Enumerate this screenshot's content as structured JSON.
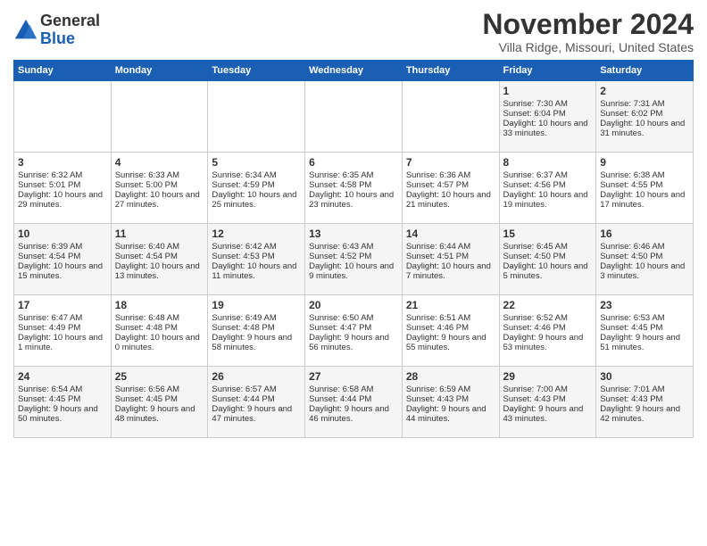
{
  "header": {
    "logo_line1": "General",
    "logo_line2": "Blue",
    "month_title": "November 2024",
    "location": "Villa Ridge, Missouri, United States"
  },
  "days_of_week": [
    "Sunday",
    "Monday",
    "Tuesday",
    "Wednesday",
    "Thursday",
    "Friday",
    "Saturday"
  ],
  "weeks": [
    [
      {
        "day": "",
        "sunrise": "",
        "sunset": "",
        "daylight": ""
      },
      {
        "day": "",
        "sunrise": "",
        "sunset": "",
        "daylight": ""
      },
      {
        "day": "",
        "sunrise": "",
        "sunset": "",
        "daylight": ""
      },
      {
        "day": "",
        "sunrise": "",
        "sunset": "",
        "daylight": ""
      },
      {
        "day": "",
        "sunrise": "",
        "sunset": "",
        "daylight": ""
      },
      {
        "day": "1",
        "sunrise": "Sunrise: 7:30 AM",
        "sunset": "Sunset: 6:04 PM",
        "daylight": "Daylight: 10 hours and 33 minutes."
      },
      {
        "day": "2",
        "sunrise": "Sunrise: 7:31 AM",
        "sunset": "Sunset: 6:02 PM",
        "daylight": "Daylight: 10 hours and 31 minutes."
      }
    ],
    [
      {
        "day": "3",
        "sunrise": "Sunrise: 6:32 AM",
        "sunset": "Sunset: 5:01 PM",
        "daylight": "Daylight: 10 hours and 29 minutes."
      },
      {
        "day": "4",
        "sunrise": "Sunrise: 6:33 AM",
        "sunset": "Sunset: 5:00 PM",
        "daylight": "Daylight: 10 hours and 27 minutes."
      },
      {
        "day": "5",
        "sunrise": "Sunrise: 6:34 AM",
        "sunset": "Sunset: 4:59 PM",
        "daylight": "Daylight: 10 hours and 25 minutes."
      },
      {
        "day": "6",
        "sunrise": "Sunrise: 6:35 AM",
        "sunset": "Sunset: 4:58 PM",
        "daylight": "Daylight: 10 hours and 23 minutes."
      },
      {
        "day": "7",
        "sunrise": "Sunrise: 6:36 AM",
        "sunset": "Sunset: 4:57 PM",
        "daylight": "Daylight: 10 hours and 21 minutes."
      },
      {
        "day": "8",
        "sunrise": "Sunrise: 6:37 AM",
        "sunset": "Sunset: 4:56 PM",
        "daylight": "Daylight: 10 hours and 19 minutes."
      },
      {
        "day": "9",
        "sunrise": "Sunrise: 6:38 AM",
        "sunset": "Sunset: 4:55 PM",
        "daylight": "Daylight: 10 hours and 17 minutes."
      }
    ],
    [
      {
        "day": "10",
        "sunrise": "Sunrise: 6:39 AM",
        "sunset": "Sunset: 4:54 PM",
        "daylight": "Daylight: 10 hours and 15 minutes."
      },
      {
        "day": "11",
        "sunrise": "Sunrise: 6:40 AM",
        "sunset": "Sunset: 4:54 PM",
        "daylight": "Daylight: 10 hours and 13 minutes."
      },
      {
        "day": "12",
        "sunrise": "Sunrise: 6:42 AM",
        "sunset": "Sunset: 4:53 PM",
        "daylight": "Daylight: 10 hours and 11 minutes."
      },
      {
        "day": "13",
        "sunrise": "Sunrise: 6:43 AM",
        "sunset": "Sunset: 4:52 PM",
        "daylight": "Daylight: 10 hours and 9 minutes."
      },
      {
        "day": "14",
        "sunrise": "Sunrise: 6:44 AM",
        "sunset": "Sunset: 4:51 PM",
        "daylight": "Daylight: 10 hours and 7 minutes."
      },
      {
        "day": "15",
        "sunrise": "Sunrise: 6:45 AM",
        "sunset": "Sunset: 4:50 PM",
        "daylight": "Daylight: 10 hours and 5 minutes."
      },
      {
        "day": "16",
        "sunrise": "Sunrise: 6:46 AM",
        "sunset": "Sunset: 4:50 PM",
        "daylight": "Daylight: 10 hours and 3 minutes."
      }
    ],
    [
      {
        "day": "17",
        "sunrise": "Sunrise: 6:47 AM",
        "sunset": "Sunset: 4:49 PM",
        "daylight": "Daylight: 10 hours and 1 minute."
      },
      {
        "day": "18",
        "sunrise": "Sunrise: 6:48 AM",
        "sunset": "Sunset: 4:48 PM",
        "daylight": "Daylight: 10 hours and 0 minutes."
      },
      {
        "day": "19",
        "sunrise": "Sunrise: 6:49 AM",
        "sunset": "Sunset: 4:48 PM",
        "daylight": "Daylight: 9 hours and 58 minutes."
      },
      {
        "day": "20",
        "sunrise": "Sunrise: 6:50 AM",
        "sunset": "Sunset: 4:47 PM",
        "daylight": "Daylight: 9 hours and 56 minutes."
      },
      {
        "day": "21",
        "sunrise": "Sunrise: 6:51 AM",
        "sunset": "Sunset: 4:46 PM",
        "daylight": "Daylight: 9 hours and 55 minutes."
      },
      {
        "day": "22",
        "sunrise": "Sunrise: 6:52 AM",
        "sunset": "Sunset: 4:46 PM",
        "daylight": "Daylight: 9 hours and 53 minutes."
      },
      {
        "day": "23",
        "sunrise": "Sunrise: 6:53 AM",
        "sunset": "Sunset: 4:45 PM",
        "daylight": "Daylight: 9 hours and 51 minutes."
      }
    ],
    [
      {
        "day": "24",
        "sunrise": "Sunrise: 6:54 AM",
        "sunset": "Sunset: 4:45 PM",
        "daylight": "Daylight: 9 hours and 50 minutes."
      },
      {
        "day": "25",
        "sunrise": "Sunrise: 6:56 AM",
        "sunset": "Sunset: 4:45 PM",
        "daylight": "Daylight: 9 hours and 48 minutes."
      },
      {
        "day": "26",
        "sunrise": "Sunrise: 6:57 AM",
        "sunset": "Sunset: 4:44 PM",
        "daylight": "Daylight: 9 hours and 47 minutes."
      },
      {
        "day": "27",
        "sunrise": "Sunrise: 6:58 AM",
        "sunset": "Sunset: 4:44 PM",
        "daylight": "Daylight: 9 hours and 46 minutes."
      },
      {
        "day": "28",
        "sunrise": "Sunrise: 6:59 AM",
        "sunset": "Sunset: 4:43 PM",
        "daylight": "Daylight: 9 hours and 44 minutes."
      },
      {
        "day": "29",
        "sunrise": "Sunrise: 7:00 AM",
        "sunset": "Sunset: 4:43 PM",
        "daylight": "Daylight: 9 hours and 43 minutes."
      },
      {
        "day": "30",
        "sunrise": "Sunrise: 7:01 AM",
        "sunset": "Sunset: 4:43 PM",
        "daylight": "Daylight: 9 hours and 42 minutes."
      }
    ]
  ]
}
